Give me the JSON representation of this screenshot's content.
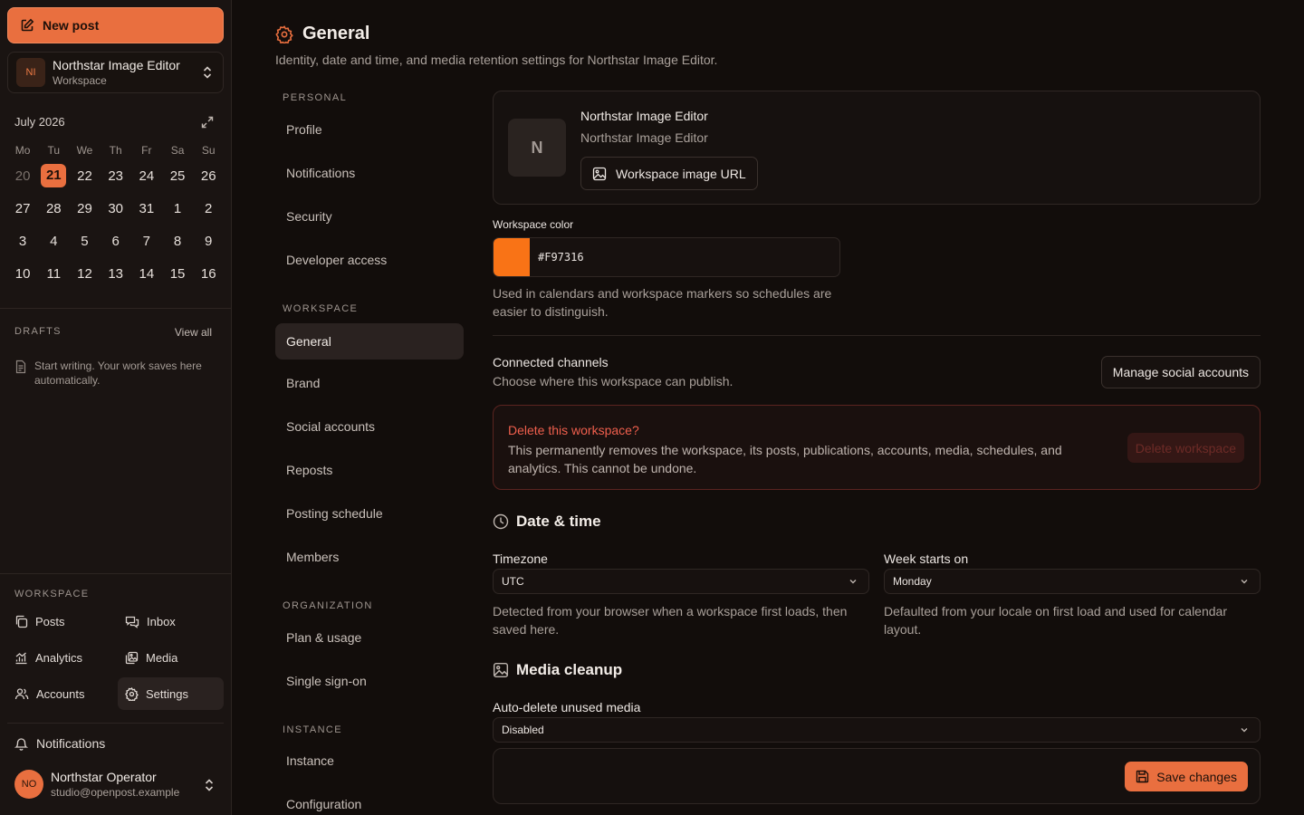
{
  "sidebar": {
    "new_post": "New post",
    "workspace": {
      "initials": "NI",
      "name": "Northstar Image Editor",
      "type": "Workspace"
    },
    "calendar": {
      "title": "July 2026",
      "days_of_week": [
        "Mo",
        "Tu",
        "We",
        "Th",
        "Fr",
        "Sa",
        "Su"
      ],
      "weeks": [
        [
          "20",
          "21",
          "22",
          "23",
          "24",
          "25",
          "26"
        ],
        [
          "27",
          "28",
          "29",
          "30",
          "31",
          "1",
          "2"
        ],
        [
          "3",
          "4",
          "5",
          "6",
          "7",
          "8",
          "9"
        ],
        [
          "10",
          "11",
          "12",
          "13",
          "14",
          "15",
          "16"
        ]
      ],
      "today": "21"
    },
    "drafts": {
      "label": "DRAFTS",
      "view_all": "View all",
      "empty": "Start writing. Your work saves here automatically."
    },
    "workspace_nav_label": "WORKSPACE",
    "nav": [
      {
        "label": "Posts",
        "icon": "copy-icon"
      },
      {
        "label": "Inbox",
        "icon": "inbox-icon"
      },
      {
        "label": "Analytics",
        "icon": "chart-icon"
      },
      {
        "label": "Media",
        "icon": "media-icon"
      },
      {
        "label": "Accounts",
        "icon": "users-icon"
      },
      {
        "label": "Settings",
        "icon": "gear-icon",
        "active": true
      }
    ],
    "notifications": "Notifications",
    "user": {
      "initials": "NO",
      "name": "Northstar Operator",
      "email": "studio@openpost.example"
    }
  },
  "header": {
    "title": "General",
    "subtitle": "Identity, date and time, and media retention settings for Northstar Image Editor."
  },
  "settings_nav": {
    "personal_label": "PERSONAL",
    "personal": [
      "Profile",
      "Notifications",
      "Security",
      "Developer access"
    ],
    "workspace_label": "WORKSPACE",
    "workspace": [
      "General",
      "Brand",
      "Social accounts",
      "Reposts",
      "Posting schedule",
      "Members"
    ],
    "organization_label": "ORGANIZATION",
    "organization": [
      "Plan & usage",
      "Single sign-on"
    ],
    "instance_label": "INSTANCE",
    "instance": [
      "Instance",
      "Configuration"
    ],
    "active": "General"
  },
  "identity": {
    "avatar_letter": "N",
    "name": "Northstar Image Editor",
    "sub": "Northstar Image Editor",
    "image_url_button": "Workspace image URL"
  },
  "workspace_color": {
    "label": "Workspace color",
    "value": "#F97316",
    "help": "Used in calendars and workspace markers so schedules are easier to distinguish."
  },
  "channels": {
    "title": "Connected channels",
    "sub": "Choose where this workspace can publish.",
    "button": "Manage social accounts"
  },
  "danger": {
    "title": "Delete this workspace?",
    "text": "This permanently removes the workspace, its posts, publications, accounts, media, schedules, and analytics. This cannot be undone.",
    "button": "Delete workspace"
  },
  "datetime": {
    "title": "Date & time",
    "timezone_label": "Timezone",
    "timezone_value": "UTC",
    "timezone_help": "Detected from your browser when a workspace first loads, then saved here.",
    "week_label": "Week starts on",
    "week_value": "Monday",
    "week_help": "Defaulted from your locale on first load and used for calendar layout."
  },
  "media": {
    "title": "Media cleanup",
    "auto_delete_label": "Auto-delete unused media",
    "auto_delete_value": "Disabled"
  },
  "save_button": "Save changes",
  "colors": {
    "accent": "#E96F3F",
    "workspace": "#F97316",
    "danger": "#EF5F4D"
  }
}
